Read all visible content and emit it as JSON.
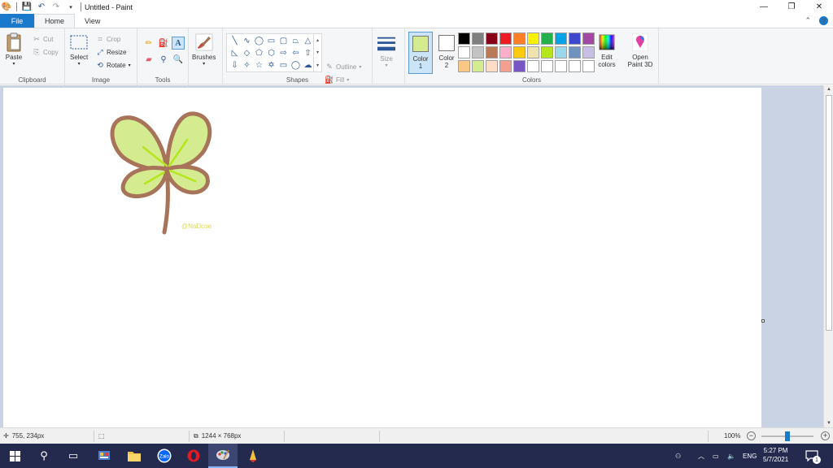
{
  "window": {
    "title": "Untitled - Paint",
    "controls": {
      "minimize": "—",
      "restore": "❐",
      "close": "✕"
    }
  },
  "tabs": {
    "file": "File",
    "home": "Home",
    "view": "View"
  },
  "ribbon": {
    "clipboard": {
      "label": "Clipboard",
      "paste": "Paste",
      "cut": "Cut",
      "copy": "Copy"
    },
    "image": {
      "label": "Image",
      "select": "Select",
      "crop": "Crop",
      "resize": "Resize",
      "rotate": "Rotate"
    },
    "tools": {
      "label": "Tools"
    },
    "brushes": {
      "label": "Brushes"
    },
    "shapes": {
      "label": "Shapes",
      "outline": "Outline",
      "fill": "Fill"
    },
    "size": {
      "label": "Size"
    },
    "colors": {
      "label": "Colors",
      "color1": "Color 1",
      "color2": "Color 2",
      "edit": "Edit colors",
      "color1_value": "#d4ec8f",
      "color2_value": "#ffffff",
      "palette": [
        "#000000",
        "#7f7f7f",
        "#880015",
        "#ed1c24",
        "#ff7f27",
        "#fff200",
        "#22b14c",
        "#00a2e8",
        "#3f48cc",
        "#a349a4",
        "#ffffff",
        "#c3c3c3",
        "#b97a57",
        "#ffaec9",
        "#ffc90e",
        "#efe4b0",
        "#b5e61d",
        "#99d9ea",
        "#7092be",
        "#c8bfe7",
        "#f9c887",
        "#d4ec8f",
        "#fddcc8",
        "#f4a090",
        "#7656c4",
        "#ffffff",
        "#ffffff",
        "#ffffff",
        "#ffffff",
        "#ffffff"
      ]
    },
    "paint3d": "Open Paint 3D"
  },
  "canvas": {
    "watermark": "@NaDcoe",
    "leaf_fill": "#d4ec8f",
    "outline_color": "#a7745a",
    "vein_color": "#b5e61d"
  },
  "status": {
    "cursor": "755, 234px",
    "selection": "",
    "canvas_size": "1244 × 768px",
    "zoom": "100%"
  },
  "taskbar": {
    "lang": "ENG",
    "time": "5:27 PM",
    "date": "5/7/2021",
    "notification_count": "1"
  }
}
